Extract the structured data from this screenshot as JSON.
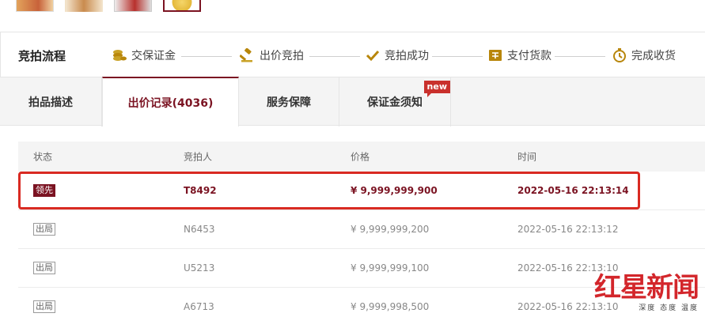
{
  "thumbnails": [
    "product-thumb-1",
    "product-thumb-2",
    "product-thumb-3",
    "product-thumb-4"
  ],
  "process": {
    "title": "竞拍流程",
    "steps": [
      {
        "label": "交保证金",
        "icon": "coins-icon"
      },
      {
        "label": "出价竞拍",
        "icon": "gavel-icon"
      },
      {
        "label": "竞拍成功",
        "icon": "check-icon"
      },
      {
        "label": "支付货款",
        "icon": "pay-icon"
      },
      {
        "label": "完成收货",
        "icon": "clock-icon"
      }
    ]
  },
  "tabs": [
    {
      "label": "拍品描述"
    },
    {
      "label": "出价记录(4036)"
    },
    {
      "label": "服务保障"
    },
    {
      "label": "保证金须知",
      "badge": "new"
    }
  ],
  "table": {
    "headers": [
      "状态",
      "竞拍人",
      "价格",
      "时间"
    ],
    "rows": [
      {
        "status": "领先",
        "bidder": "T8492",
        "price": "¥ 9,999,999,900",
        "time": "2022-05-16 22:13:14"
      },
      {
        "status": "出局",
        "bidder": "N6453",
        "price": "¥ 9,999,999,200",
        "time": "2022-05-16 22:13:12"
      },
      {
        "status": "出局",
        "bidder": "U5213",
        "price": "¥ 9,999,999,100",
        "time": "2022-05-16 22:13:10"
      },
      {
        "status": "出局",
        "bidder": "A6713",
        "price": "¥ 9,999,998,500",
        "time": "2022-05-16 22:13:10"
      }
    ]
  },
  "watermark": {
    "main": "红星新闻",
    "sub": "深度 态度 温度"
  },
  "colors": {
    "accent": "#7b1322",
    "highlight": "#d92a22",
    "icon": "#b8860b"
  }
}
